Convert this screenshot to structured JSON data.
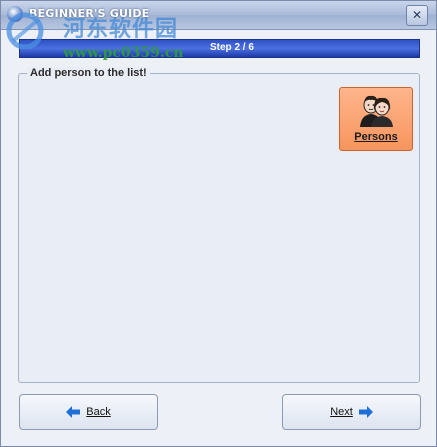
{
  "window": {
    "title": "BEGINNER'S GUIDE",
    "close_glyph": "✕"
  },
  "watermark": {
    "chinese_text": "河东软件园",
    "url": "www.pc0359.cn"
  },
  "step": {
    "text": "Step 2 / 6"
  },
  "panel": {
    "title": "Add person to the list!"
  },
  "persons_button": {
    "label": "Persons",
    "icon": "persons-icon"
  },
  "navigation": {
    "back_label": "Back",
    "next_label": "Next",
    "back_icon": "arrow-left-icon",
    "next_icon": "arrow-right-icon"
  },
  "colors": {
    "accent_bar": "#2e52c4",
    "persons_button": "#f7955d",
    "arrow": "#1e6fd8"
  }
}
